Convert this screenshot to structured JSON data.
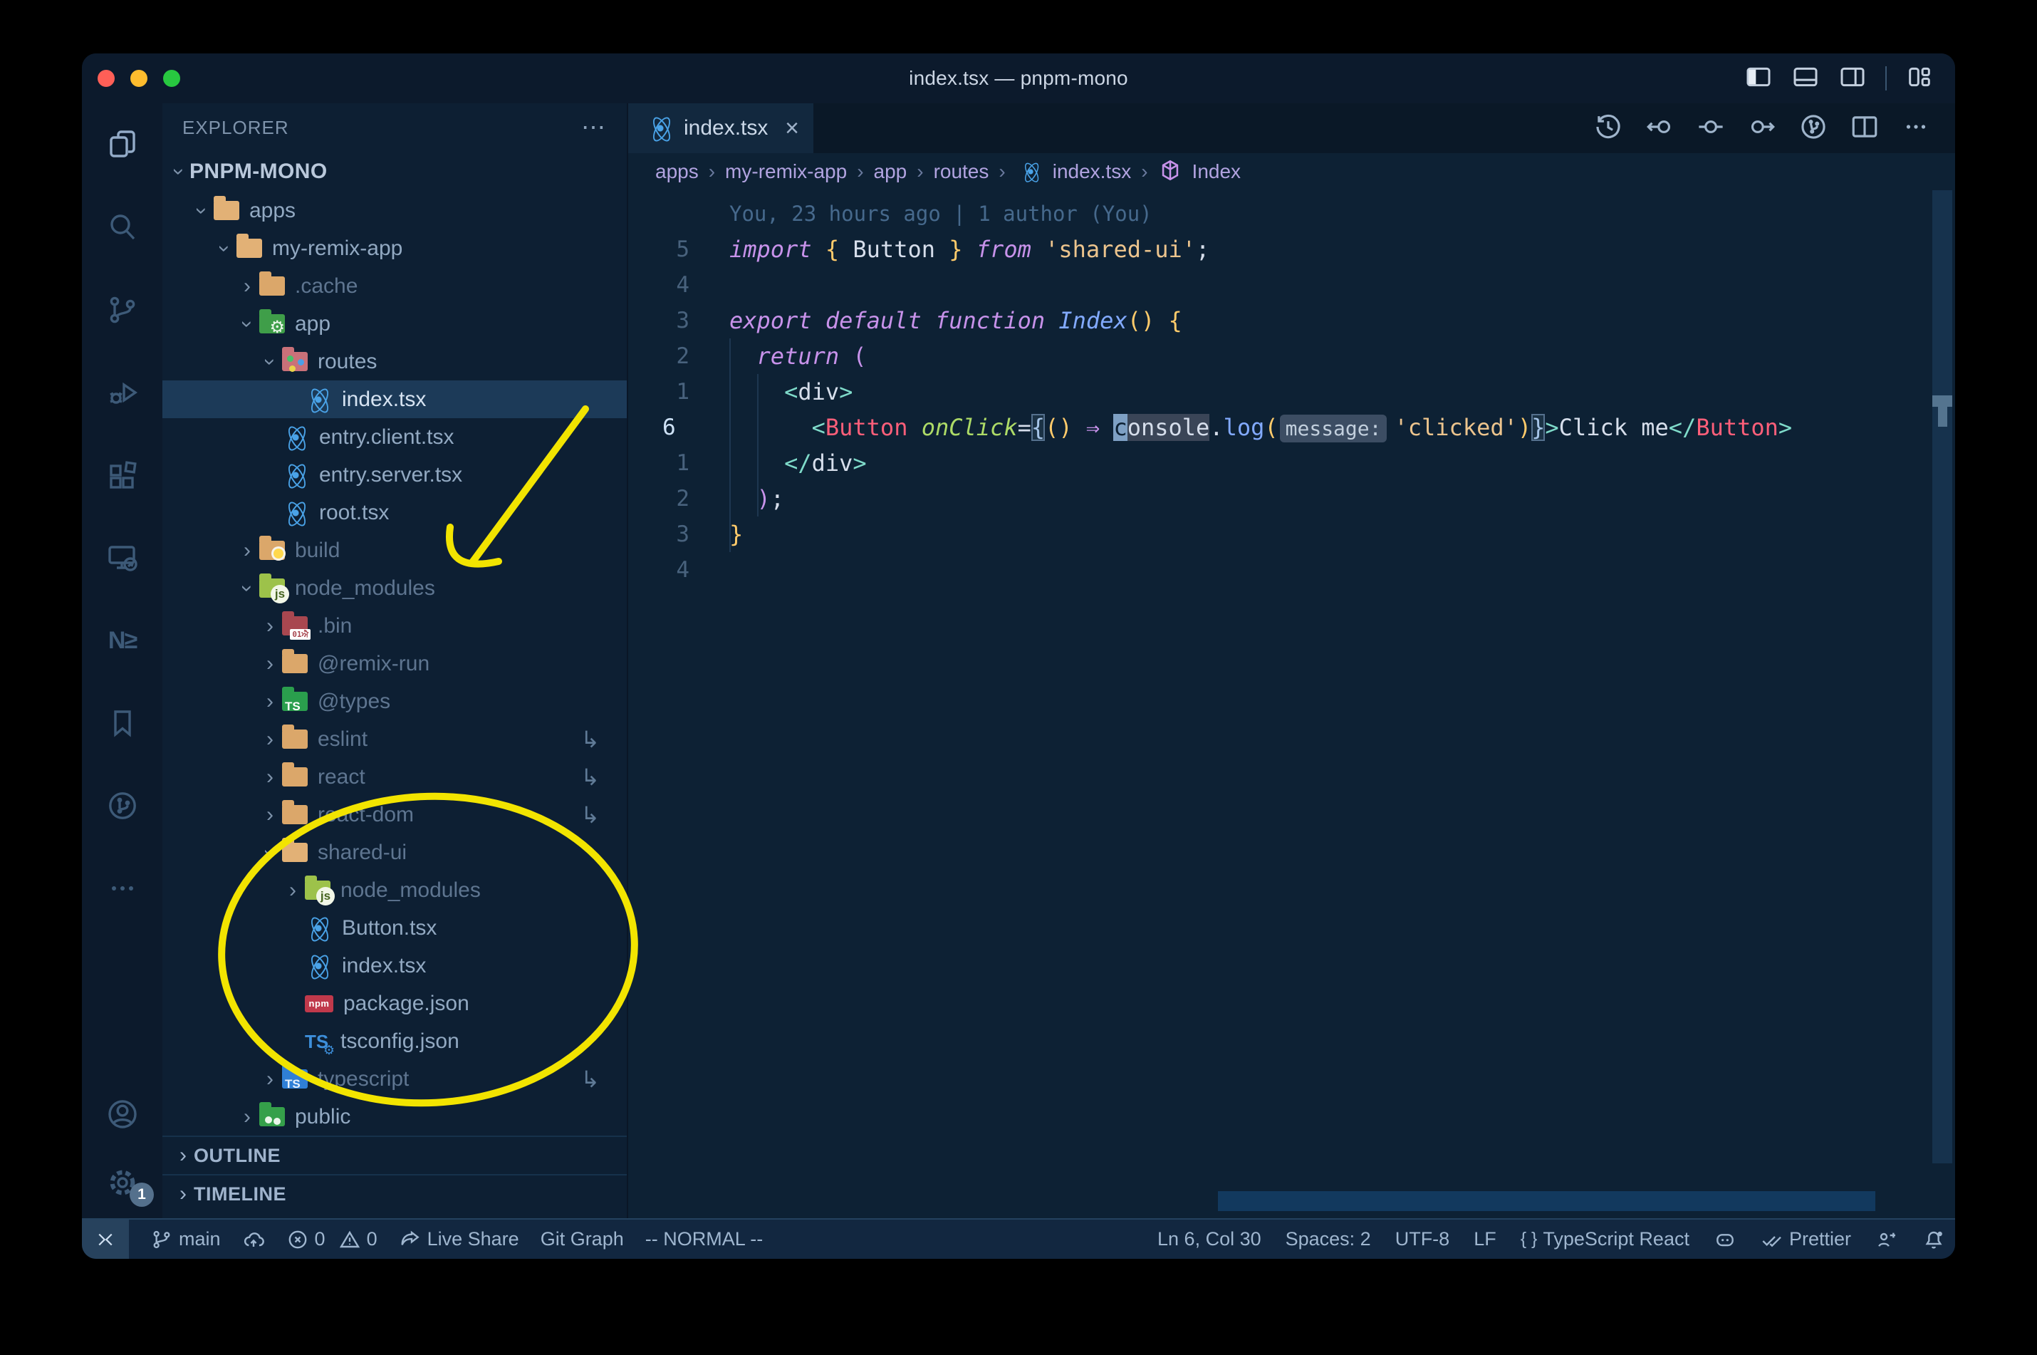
{
  "window": {
    "title": "index.tsx — pnpm-mono",
    "controls": [
      "toggle-primary-sidebar",
      "toggle-panel",
      "toggle-secondary-sidebar",
      "customize-layout"
    ]
  },
  "colors": {
    "annotation_yellow": "#f2e400",
    "editor_bg": "#0d2134",
    "selection_bg": "#1c3a58",
    "react_icon_blue": "#4aa3e8",
    "keyword_purple": "#c792ea",
    "string_orange": "#ecc48d"
  },
  "activity_bar": {
    "icons": [
      "explorer-icon",
      "search-icon",
      "source-control-icon",
      "run-debug-icon",
      "extensions-icon",
      "remote-explorer-icon",
      "nx-console-icon",
      "bookmarks-icon",
      "git-graph-icon",
      "more-icon",
      "account-icon",
      "settings-icon"
    ],
    "nx_glyph": "N≥",
    "settings_badge": "1"
  },
  "explorer": {
    "header": "EXPLORER",
    "actions": "⋯",
    "workspace": "PNPM-MONO",
    "tree": [
      {
        "label": "apps",
        "icon": "i-folder-tan-open folder",
        "level": 1,
        "chevron": "down"
      },
      {
        "label": "my-remix-app",
        "icon": "i-folder-tan-open folder",
        "level": 2,
        "chevron": "down"
      },
      {
        "label": ".cache",
        "icon": "i-folder-tan folder",
        "level": 3,
        "chevron": "right",
        "dim": true
      },
      {
        "label": "app",
        "icon": "i-folder-app folder",
        "level": 3,
        "chevron": "down"
      },
      {
        "label": "routes",
        "icon": "i-folder-routes folder",
        "level": 4,
        "chevron": "down"
      },
      {
        "label": "index.tsx",
        "icon": "i-react",
        "level": 5,
        "selected": true
      },
      {
        "label": "entry.client.tsx",
        "icon": "i-react",
        "level": 4
      },
      {
        "label": "entry.server.tsx",
        "icon": "i-react",
        "level": 4
      },
      {
        "label": "root.tsx",
        "icon": "i-react",
        "level": 4
      },
      {
        "label": "build",
        "icon": "i-folder-build folder",
        "level": 3,
        "chevron": "right",
        "dim": true
      },
      {
        "label": "node_modules",
        "icon": "i-folder-nm folder",
        "level": 3,
        "chevron": "down",
        "dim": true
      },
      {
        "label": ".bin",
        "icon": "i-folder-bin folder",
        "level": 4,
        "chevron": "right",
        "dim": true
      },
      {
        "label": "@remix-run",
        "icon": "i-folder-tan folder",
        "level": 4,
        "chevron": "right",
        "dim": true
      },
      {
        "label": "@types",
        "icon": "i-folder-types folder",
        "level": 4,
        "chevron": "right",
        "dim": true
      },
      {
        "label": "eslint",
        "icon": "i-folder-tan folder",
        "level": 4,
        "chevron": "right",
        "dim": true,
        "symlink": true
      },
      {
        "label": "react",
        "icon": "i-folder-tan folder",
        "level": 4,
        "chevron": "right",
        "dim": true,
        "symlink": true
      },
      {
        "label": "react-dom",
        "icon": "i-folder-tan folder",
        "level": 4,
        "chevron": "right",
        "dim": true,
        "symlink": true
      },
      {
        "label": "shared-ui",
        "icon": "i-folder-tan-open folder",
        "level": 4,
        "chevron": "down",
        "dim": true
      },
      {
        "label": "node_modules",
        "icon": "i-folder-nm folder",
        "level": 5,
        "chevron": "right",
        "dim": true
      },
      {
        "label": "Button.tsx",
        "icon": "i-react",
        "level": 5
      },
      {
        "label": "index.tsx",
        "icon": "i-react",
        "level": 5
      },
      {
        "label": "package.json",
        "icon": "i-npm",
        "level": 5
      },
      {
        "label": "tsconfig.json",
        "icon": "i-tsconfig",
        "level": 5
      },
      {
        "label": "typescript",
        "icon": "i-folder-ts folder",
        "level": 4,
        "chevron": "right",
        "dim": true,
        "symlink": true
      },
      {
        "label": "public",
        "icon": "i-folder-public folder",
        "level": 3,
        "chevron": "right"
      }
    ],
    "sections": [
      {
        "label": "OUTLINE"
      },
      {
        "label": "TIMELINE"
      }
    ]
  },
  "tabs": {
    "active_label": "index.tsx",
    "close_glyph": "×"
  },
  "editor_actions": [
    "timeline-icon",
    "previous-change-icon",
    "open-change-icon",
    "next-change-icon",
    "git-graph-icon",
    "split-editor-icon",
    "more-actions-icon"
  ],
  "breadcrumbs": {
    "items": [
      {
        "label": "apps"
      },
      {
        "label": "my-remix-app"
      },
      {
        "label": "app"
      },
      {
        "label": "routes"
      },
      {
        "label": "index.tsx",
        "icon": "react-icon"
      },
      {
        "label": "Index",
        "icon": "symbol-cube-icon"
      }
    ],
    "separator": "›"
  },
  "editor": {
    "blame": "You, 23 hours ago | 1 author (You)",
    "lines": [
      {
        "num": "5",
        "tokens": [
          {
            "t": "import ",
            "c": "kw"
          },
          {
            "t": "{ ",
            "c": "brace"
          },
          {
            "t": "Button",
            "c": "fg"
          },
          {
            "t": " }",
            "c": "brace"
          },
          {
            "t": " from ",
            "c": "kw"
          },
          {
            "t": "'shared-ui'",
            "c": "str"
          },
          {
            "t": ";",
            "c": "fg"
          }
        ]
      },
      {
        "num": "4",
        "tokens": []
      },
      {
        "num": "3",
        "tokens": [
          {
            "t": "export ",
            "c": "kw"
          },
          {
            "t": "default ",
            "c": "kw"
          },
          {
            "t": "function ",
            "c": "kw"
          },
          {
            "t": "Index",
            "c": "fn"
          },
          {
            "t": "()",
            "c": "brace"
          },
          {
            "t": " ",
            "c": "fg"
          },
          {
            "t": "{",
            "c": "brace"
          }
        ]
      },
      {
        "num": "2",
        "tokens": [
          {
            "t": "  ",
            "c": "fg"
          },
          {
            "t": "return ",
            "c": "kw"
          },
          {
            "t": "(",
            "c": "paren"
          }
        ]
      },
      {
        "num": "1",
        "tokens": [
          {
            "t": "    ",
            "c": "fg"
          },
          {
            "t": "<",
            "c": "tagb"
          },
          {
            "t": "div",
            "c": "fg"
          },
          {
            "t": ">",
            "c": "tagb"
          }
        ]
      },
      {
        "num": "6",
        "current": true,
        "tokens": [
          {
            "t": "      ",
            "c": "fg"
          },
          {
            "t": "<",
            "c": "tagb"
          },
          {
            "t": "Button",
            "c": "comp"
          },
          {
            "t": " ",
            "c": "fg"
          },
          {
            "t": "onClick",
            "c": "attr"
          },
          {
            "t": "=",
            "c": "fg"
          },
          {
            "t": "{",
            "c": "bm"
          },
          {
            "t": "()",
            "c": "brace"
          },
          {
            "t": " ",
            "c": "fg"
          },
          {
            "t": "⇒",
            "c": "op"
          },
          {
            "t": " ",
            "c": "fg"
          },
          {
            "t": "c",
            "c": "cursor"
          },
          {
            "t": "onsole",
            "c": "whl"
          },
          {
            "t": ".",
            "c": "fg"
          },
          {
            "t": "log",
            "c": "meth"
          },
          {
            "t": "(",
            "c": "brace"
          },
          {
            "t": "message:",
            "c": "inlay"
          },
          {
            "t": "'clicked'",
            "c": "str"
          },
          {
            "t": ")",
            "c": "brace"
          },
          {
            "t": "}",
            "c": "bm"
          },
          {
            "t": ">",
            "c": "tagb"
          },
          {
            "t": "Click me",
            "c": "fg"
          },
          {
            "t": "</",
            "c": "tagb"
          },
          {
            "t": "Button",
            "c": "comp"
          },
          {
            "t": ">",
            "c": "tagb"
          }
        ]
      },
      {
        "num": "1",
        "tokens": [
          {
            "t": "    ",
            "c": "fg"
          },
          {
            "t": "</",
            "c": "tagb"
          },
          {
            "t": "div",
            "c": "fg"
          },
          {
            "t": ">",
            "c": "tagb"
          }
        ]
      },
      {
        "num": "2",
        "tokens": [
          {
            "t": "  ",
            "c": "fg"
          },
          {
            "t": ")",
            "c": "paren"
          },
          {
            "t": ";",
            "c": "fg"
          }
        ]
      },
      {
        "num": "3",
        "tokens": [
          {
            "t": "}",
            "c": "brace"
          }
        ]
      },
      {
        "num": "4",
        "tokens": []
      }
    ]
  },
  "status_bar": {
    "remote_icon": "remote-indicator",
    "branch": "main",
    "errors": "0",
    "warnings": "0",
    "live_share": "Live Share",
    "git_graph": "Git Graph",
    "vim_mode": "-- NORMAL --",
    "cursor_position": "Ln 6, Col 30",
    "indentation": "Spaces: 2",
    "encoding": "UTF-8",
    "eol": "LF",
    "language_mode": "TypeScript React",
    "formatter": "Prettier"
  }
}
